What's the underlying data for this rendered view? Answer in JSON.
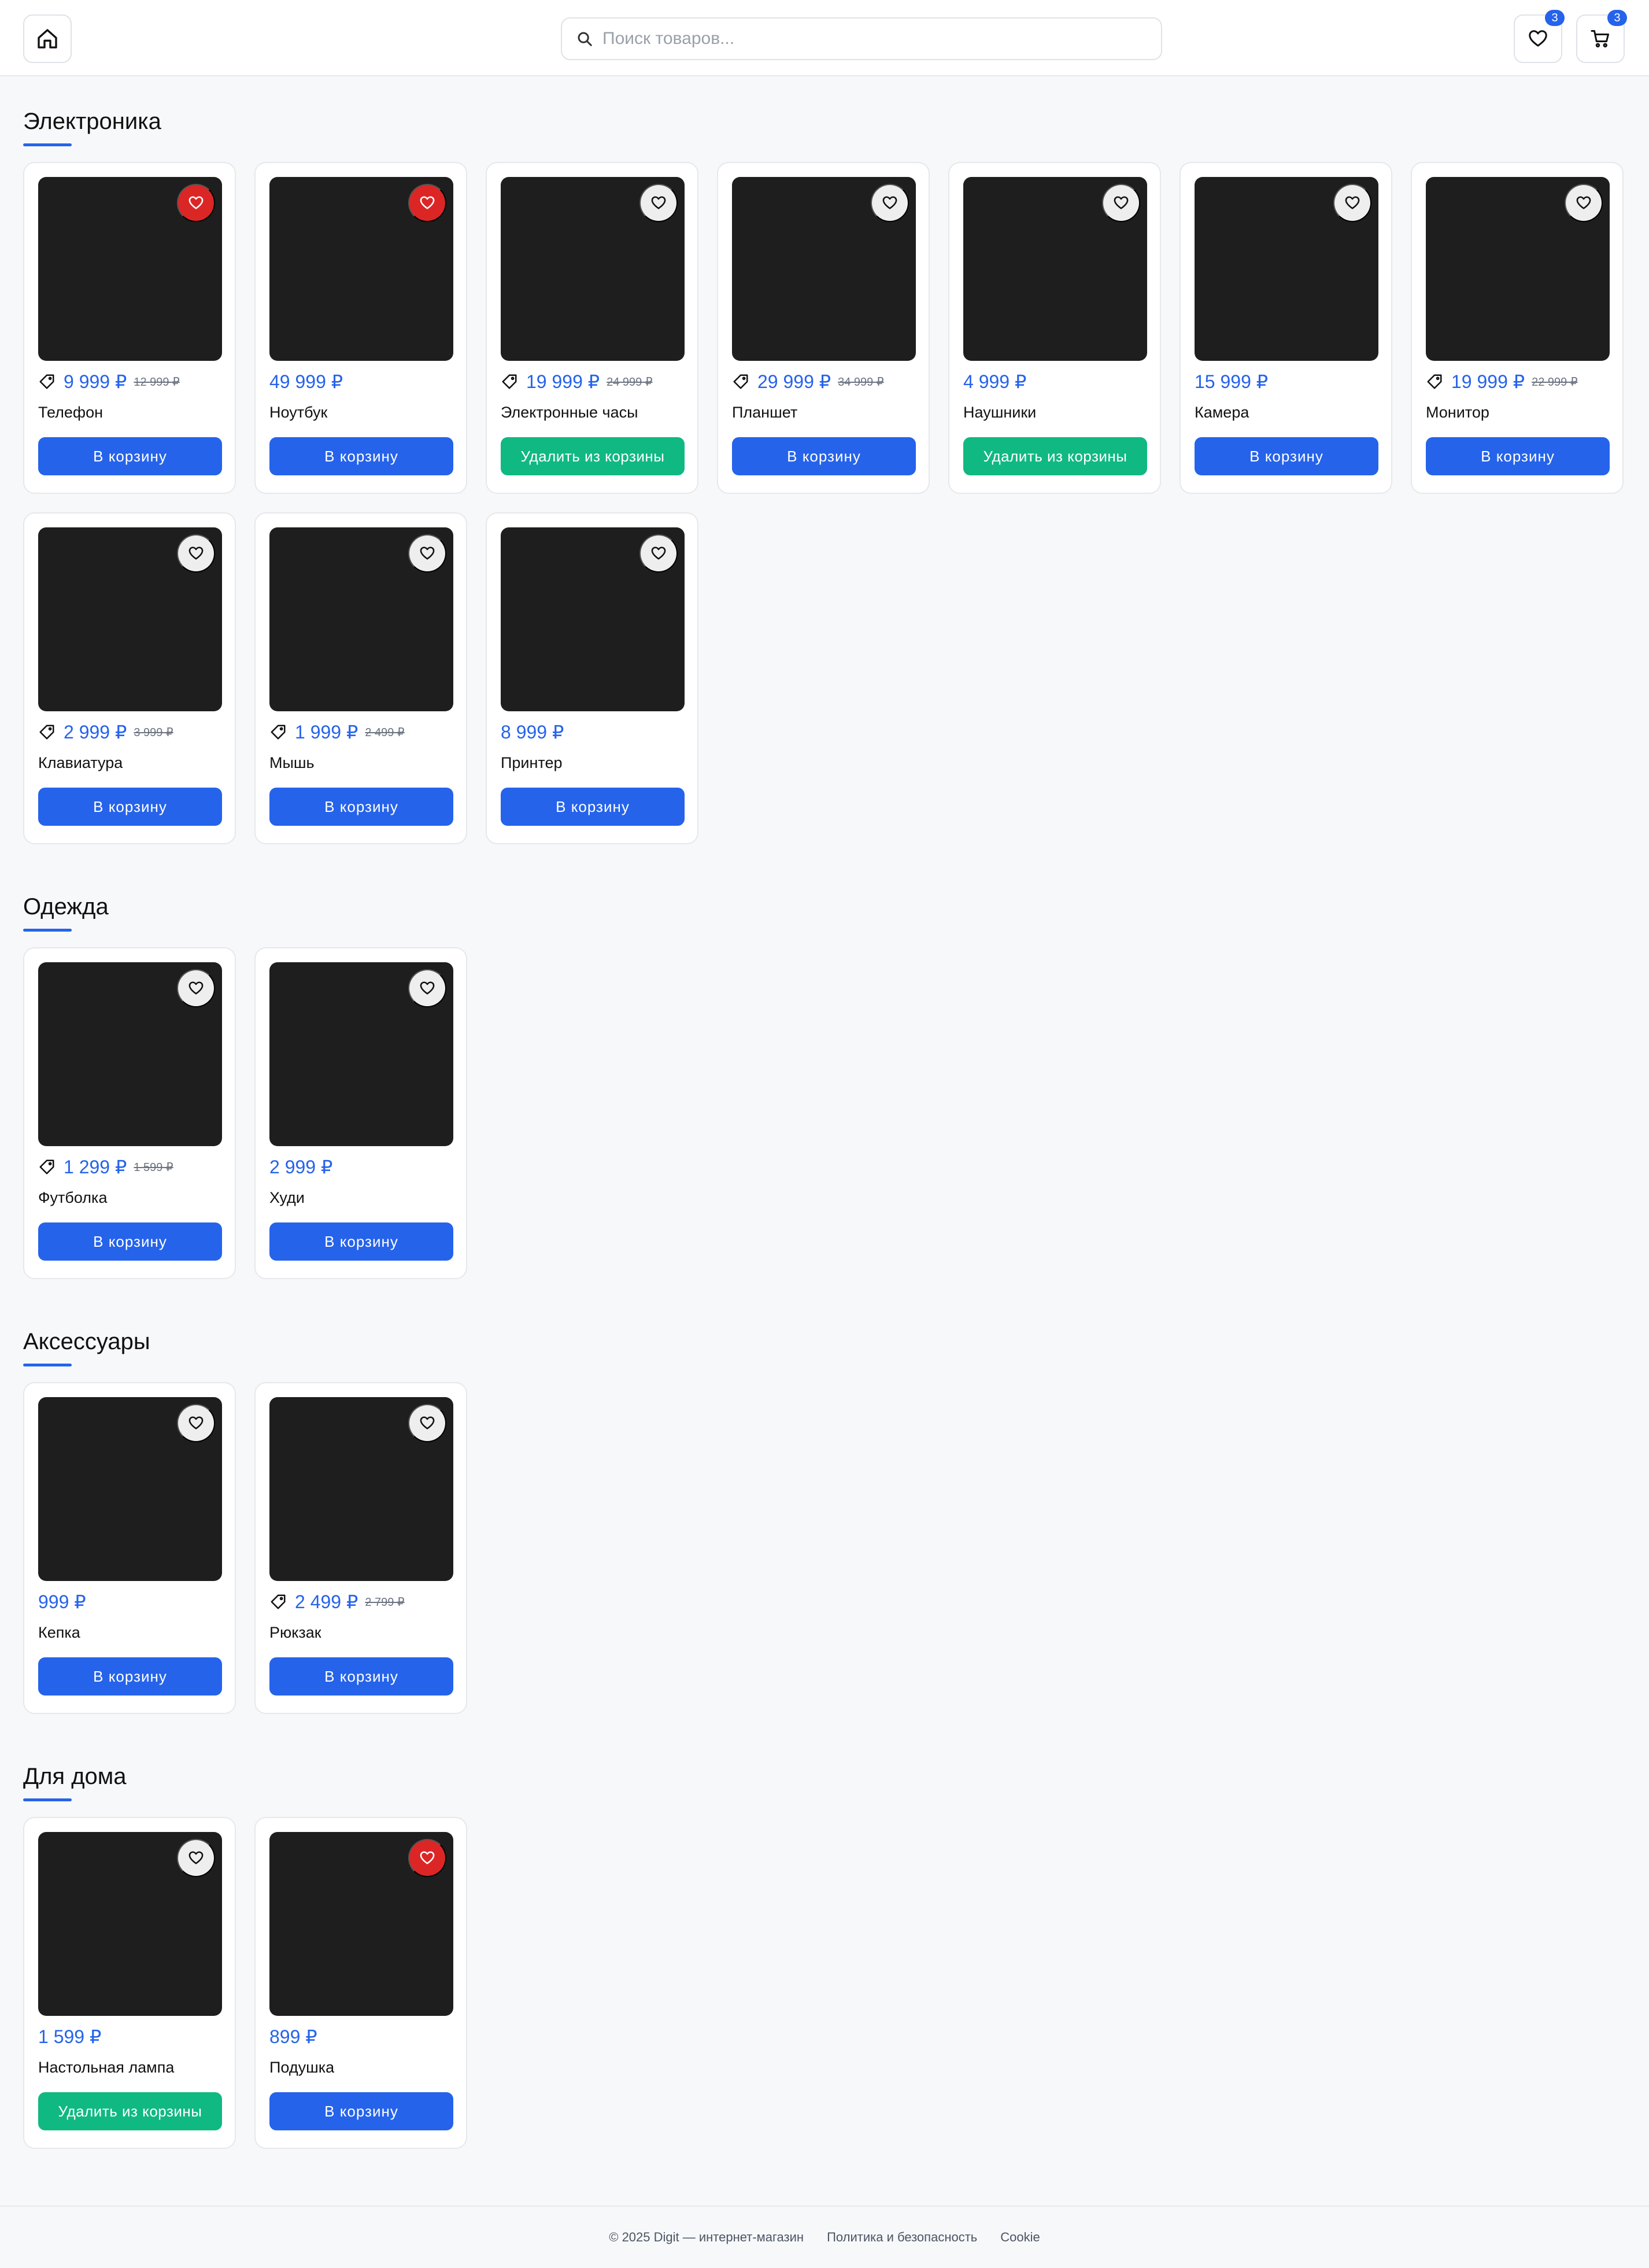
{
  "header": {
    "search_placeholder": "Поиск товаров...",
    "favorites_count": "3",
    "cart_count": "3"
  },
  "colors": {
    "accent": "#2563eb",
    "remove": "#10b981",
    "fav_active": "#dc2626"
  },
  "sections": [
    {
      "title": "Электроника",
      "products": [
        {
          "name": "Телефон",
          "price": "9 999 ₽",
          "old_price": "12 999 ₽",
          "fav": true,
          "in_cart": false
        },
        {
          "name": "Ноутбук",
          "price": "49 999 ₽",
          "old_price": "",
          "fav": true,
          "in_cart": false
        },
        {
          "name": "Электронные часы",
          "price": "19 999 ₽",
          "old_price": "24 999 ₽",
          "fav": false,
          "in_cart": true
        },
        {
          "name": "Планшет",
          "price": "29 999 ₽",
          "old_price": "34 999 ₽",
          "fav": false,
          "in_cart": false
        },
        {
          "name": "Наушники",
          "price": "4 999 ₽",
          "old_price": "",
          "fav": false,
          "in_cart": true
        },
        {
          "name": "Камера",
          "price": "15 999 ₽",
          "old_price": "",
          "fav": false,
          "in_cart": false
        },
        {
          "name": "Монитор",
          "price": "19 999 ₽",
          "old_price": "22 999 ₽",
          "fav": false,
          "in_cart": false
        },
        {
          "name": "Клавиатура",
          "price": "2 999 ₽",
          "old_price": "3 999 ₽",
          "fav": false,
          "in_cart": false
        },
        {
          "name": "Мышь",
          "price": "1 999 ₽",
          "old_price": "2 499 ₽",
          "fav": false,
          "in_cart": false
        },
        {
          "name": "Принтер",
          "price": "8 999 ₽",
          "old_price": "",
          "fav": false,
          "in_cart": false
        }
      ]
    },
    {
      "title": "Одежда",
      "products": [
        {
          "name": "Футболка",
          "price": "1 299 ₽",
          "old_price": "1 599 ₽",
          "fav": false,
          "in_cart": false
        },
        {
          "name": "Худи",
          "price": "2 999 ₽",
          "old_price": "",
          "fav": false,
          "in_cart": false
        }
      ]
    },
    {
      "title": "Аксессуары",
      "products": [
        {
          "name": "Кепка",
          "price": "999 ₽",
          "old_price": "",
          "fav": false,
          "in_cart": false
        },
        {
          "name": "Рюкзак",
          "price": "2 499 ₽",
          "old_price": "2 799 ₽",
          "fav": false,
          "in_cart": false
        }
      ]
    },
    {
      "title": "Для дома",
      "products": [
        {
          "name": "Настольная лампа",
          "price": "1 599 ₽",
          "old_price": "",
          "fav": false,
          "in_cart": true
        },
        {
          "name": "Подушка",
          "price": "899 ₽",
          "old_price": "",
          "fav": true,
          "in_cart": false
        }
      ]
    }
  ],
  "labels": {
    "add_to_cart": "В корзину",
    "remove_from_cart": "Удалить из корзины"
  },
  "footer": {
    "copyright": "© 2025 Digit — интернет-магазин",
    "privacy": "Политика и безопасность",
    "cookie": "Cookie"
  },
  "icons": {
    "home": "home-icon",
    "search": "search-icon",
    "favorites": "heart-icon",
    "cart": "cart-icon",
    "discount": "tag-icon"
  }
}
